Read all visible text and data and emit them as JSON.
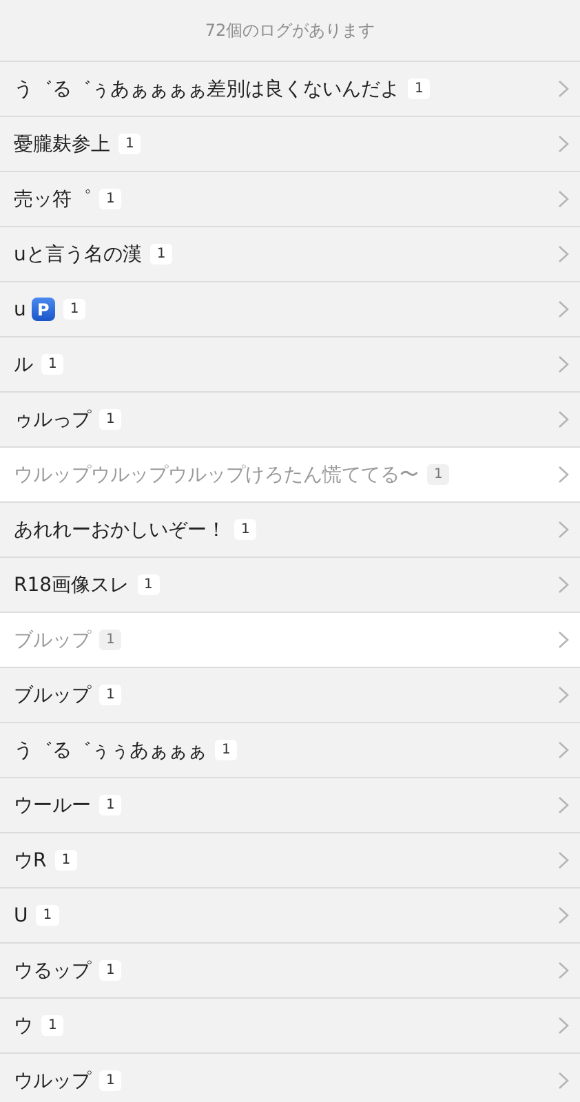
{
  "header": "72個のログがあります",
  "rows": [
    {
      "title": "う゛る゛ぅあぁぁぁぁ差別は良くないんだよ",
      "count": "1",
      "dimmed": false
    },
    {
      "title": "憂朧麸参上",
      "count": "1",
      "dimmed": false
    },
    {
      "title": "売ッ符゜",
      "count": "1",
      "dimmed": false
    },
    {
      "title": "uと言う名の漢",
      "count": "1",
      "dimmed": false
    },
    {
      "title": "u",
      "icon": {
        "kind": "parking",
        "glyph": "P"
      },
      "count": "1",
      "dimmed": false
    },
    {
      "title": "ル",
      "count": "1",
      "dimmed": false
    },
    {
      "title": "ゥルっプ",
      "count": "1",
      "dimmed": false
    },
    {
      "title": "ウルップウルップウルップけろたん慌ててる〜",
      "count": "1",
      "dimmed": true
    },
    {
      "title": "あれれーおかしいぞー！",
      "count": "1",
      "dimmed": false
    },
    {
      "title": "R18画像スレ",
      "count": "1",
      "dimmed": false
    },
    {
      "title": "ブルップ",
      "count": "1",
      "dimmed": true
    },
    {
      "title": "ブルップ",
      "count": "1",
      "dimmed": false
    },
    {
      "title": "う゛る゛ぅぅあぁぁぁ",
      "count": "1",
      "dimmed": false
    },
    {
      "title": "ウールー",
      "count": "1",
      "dimmed": false
    },
    {
      "title": "ウR",
      "count": "1",
      "dimmed": false
    },
    {
      "title": "U",
      "count": "1",
      "dimmed": false
    },
    {
      "title": "ウるップ",
      "count": "1",
      "dimmed": false
    },
    {
      "title": "ウ",
      "count": "1",
      "dimmed": false
    },
    {
      "title": "ウルップ",
      "count": "1",
      "dimmed": false
    }
  ]
}
